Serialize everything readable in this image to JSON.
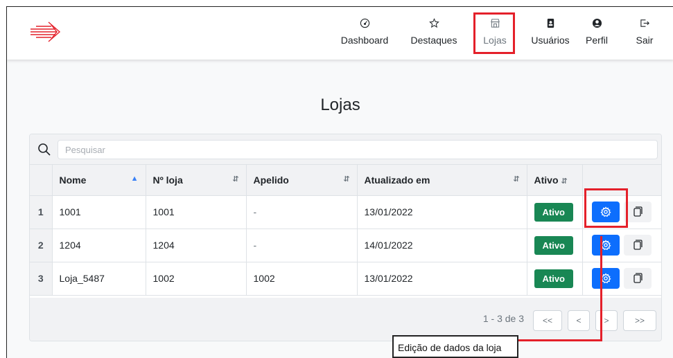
{
  "nav": {
    "items": [
      {
        "label": "Dashboard",
        "icon": "gauge-icon"
      },
      {
        "label": "Destaques",
        "icon": "star-icon"
      },
      {
        "label": "Lojas",
        "icon": "shop-icon"
      },
      {
        "label": "Usuários",
        "icon": "id-badge-icon"
      },
      {
        "label": "Perfil",
        "icon": "person-circle-icon"
      },
      {
        "label": "Sair",
        "icon": "logout-icon"
      }
    ],
    "active": "Lojas"
  },
  "page": {
    "title": "Lojas"
  },
  "search": {
    "placeholder": "Pesquisar",
    "value": ""
  },
  "table": {
    "columns": [
      "Nome",
      "Nº loja",
      "Apelido",
      "Atualizado em",
      "Ativo"
    ],
    "rows": [
      {
        "index": "1",
        "nome": "1001",
        "numero": "1001",
        "apelido": "-",
        "atualizado": "13/01/2022",
        "ativo": "Ativo"
      },
      {
        "index": "2",
        "nome": "1204",
        "numero": "1204",
        "apelido": "-",
        "atualizado": "14/01/2022",
        "ativo": "Ativo"
      },
      {
        "index": "3",
        "nome": "Loja_5487",
        "numero": "1002",
        "apelido": "1002",
        "atualizado": "13/01/2022",
        "ativo": "Ativo"
      }
    ]
  },
  "pagination": {
    "info": "1 - 3 de 3",
    "first": "<<",
    "prev": "<",
    "next": ">",
    "last": ">>"
  },
  "annotation": {
    "text": "Edição de dados da loja"
  },
  "colors": {
    "accent": "#0d6efd",
    "success": "#198754",
    "highlight": "#e4202a",
    "logo": "#e4202a"
  }
}
